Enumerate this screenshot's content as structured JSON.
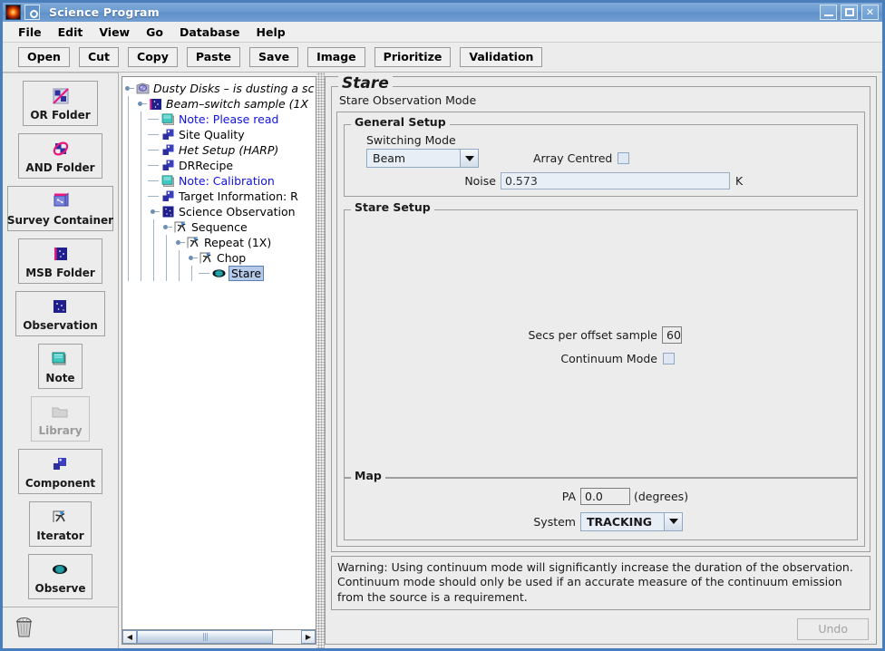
{
  "window": {
    "title": "Science Program",
    "app_icon": "star-glow-icon",
    "doc_icon": "document-icon",
    "controls": [
      {
        "name": "minimize-button",
        "glyph": "minimize-icon"
      },
      {
        "name": "maximize-button",
        "glyph": "maximize-icon"
      },
      {
        "name": "close-button",
        "glyph": "close-icon",
        "label": "✕"
      }
    ]
  },
  "menubar": {
    "items": [
      "File",
      "Edit",
      "View",
      "Go",
      "Database",
      "Help"
    ]
  },
  "toolbar": {
    "buttons": [
      "Open",
      "Cut",
      "Copy",
      "Paste",
      "Save",
      "Image",
      "Prioritize",
      "Validation"
    ]
  },
  "palette": {
    "items": [
      {
        "label": "OR Folder",
        "icon": "or-folder-icon",
        "disabled": false,
        "wide": false
      },
      {
        "label": "AND Folder",
        "icon": "and-folder-icon",
        "disabled": false,
        "wide": false
      },
      {
        "label": "Survey Container",
        "icon": "survey-container-icon",
        "disabled": false,
        "wide": true
      },
      {
        "label": "MSB Folder",
        "icon": "msb-folder-icon",
        "disabled": false,
        "wide": false
      },
      {
        "label": "Observation",
        "icon": "observation-icon",
        "disabled": false,
        "wide": false
      },
      {
        "label": "Note",
        "icon": "note-icon",
        "disabled": false,
        "wide": false
      },
      {
        "label": "Library",
        "icon": "library-folder-icon",
        "disabled": true,
        "wide": false
      },
      {
        "label": "Component",
        "icon": "component-icon",
        "disabled": false,
        "wide": false
      },
      {
        "label": "Iterator",
        "icon": "iterator-icon",
        "disabled": false,
        "wide": false
      },
      {
        "label": "Observe",
        "icon": "observe-eye-icon",
        "disabled": false,
        "wide": false
      }
    ],
    "trash_icon": "trash-can-icon"
  },
  "tree": {
    "nodes": [
      {
        "label": "Dusty Disks – is dusting a sc",
        "depth": 0,
        "icon": "science-program-icon",
        "italic": true,
        "note": false,
        "selected": false,
        "expander": true
      },
      {
        "label": "Beam–switch sample (1X",
        "depth": 1,
        "icon": "msb-folder-icon",
        "italic": true,
        "note": false,
        "selected": false,
        "expander": true
      },
      {
        "label": "Note: Please read",
        "depth": 2,
        "icon": "note-icon",
        "italic": false,
        "note": true,
        "selected": false,
        "expander": false
      },
      {
        "label": "Site Quality",
        "depth": 2,
        "icon": "component-icon",
        "italic": false,
        "note": false,
        "selected": false,
        "expander": false
      },
      {
        "label": "Het Setup (HARP)",
        "depth": 2,
        "icon": "component-icon",
        "italic": true,
        "note": false,
        "selected": false,
        "expander": false
      },
      {
        "label": "DRRecipe",
        "depth": 2,
        "icon": "component-icon",
        "italic": false,
        "note": false,
        "selected": false,
        "expander": false
      },
      {
        "label": "Note: Calibration",
        "depth": 2,
        "icon": "note-icon",
        "italic": false,
        "note": true,
        "selected": false,
        "expander": false
      },
      {
        "label": "Target Information: R",
        "depth": 2,
        "icon": "component-icon",
        "italic": false,
        "note": false,
        "selected": false,
        "expander": false
      },
      {
        "label": "Science Observation",
        "depth": 2,
        "icon": "observation-icon",
        "italic": false,
        "note": false,
        "selected": false,
        "expander": true
      },
      {
        "label": "Sequence",
        "depth": 3,
        "icon": "iterator-icon",
        "italic": false,
        "note": false,
        "selected": false,
        "expander": true
      },
      {
        "label": "Repeat (1X)",
        "depth": 4,
        "icon": "iterator-icon",
        "italic": false,
        "note": false,
        "selected": false,
        "expander": true
      },
      {
        "label": "Chop",
        "depth": 5,
        "icon": "iterator-icon",
        "italic": false,
        "note": false,
        "selected": false,
        "expander": true
      },
      {
        "label": "Stare",
        "depth": 6,
        "icon": "observe-eye-icon",
        "italic": false,
        "note": false,
        "selected": true,
        "expander": false
      }
    ],
    "hscrollbar": {
      "left_arrow": "◀",
      "right_arrow": "▶",
      "grip": "|||"
    }
  },
  "editor": {
    "title": "Stare",
    "subtitle": "Stare Observation Mode",
    "general_setup": {
      "legend": "General Setup",
      "switching_mode_label": "Switching Mode",
      "switching_mode_value": "Beam",
      "array_centred_label": "Array Centred",
      "array_centred_checked": false,
      "noise_label": "Noise",
      "noise_value": "0.573",
      "noise_unit": "K"
    },
    "stare_setup": {
      "legend": "Stare Setup",
      "secs_label": "Secs per offset sample",
      "secs_value": "60",
      "continuum_label": "Continuum Mode",
      "continuum_checked": false
    },
    "map": {
      "legend": "Map",
      "pa_label": "PA",
      "pa_value": "0.0",
      "pa_unit": "(degrees)",
      "system_label": "System",
      "system_value": "TRACKING"
    },
    "warning": "Warning: Using continuum mode will significantly increase the duration of the observation. Continuum mode should only be used if an accurate measure of the continuum emission from the source is a requirement.",
    "undo_label": "Undo"
  },
  "colors": {
    "titlebar": "#6b9bd0",
    "window_border": "#4a7ebb",
    "panel_bg": "#ececec",
    "note_text": "#1111dd",
    "selection": "#b5c9e8",
    "field_bg": "#e9eff7"
  }
}
